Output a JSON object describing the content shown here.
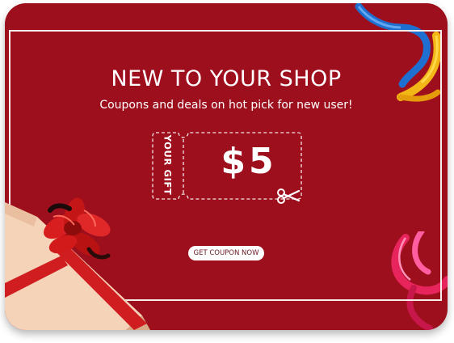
{
  "promo": {
    "headline": "NEW TO YOUR SHOP",
    "subtitle": "Coupons and deals on hot pick for new user!",
    "ticket": {
      "side_label": "YOUR GIFT",
      "amount": "$5"
    },
    "cta_label": "GET COUPON NOW"
  },
  "colors": {
    "background": "#9e0f1d",
    "text": "#ffffff",
    "button": "#ffffff",
    "gift_box": "#f5d3b8",
    "ribbon": "#d01e1e"
  },
  "icons": [
    "scissors-icon",
    "gift-box-illustration",
    "ribbon-streamer-illustration"
  ]
}
